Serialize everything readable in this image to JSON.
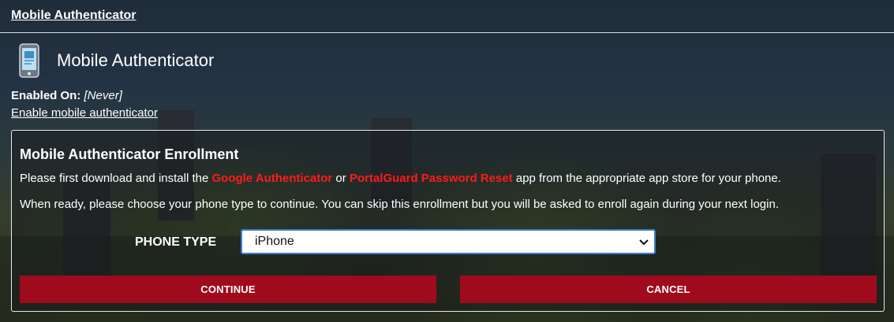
{
  "topbar": {
    "link_label": "Mobile Authenticator"
  },
  "header": {
    "title": "Mobile Authenticator",
    "icon": "mobile-phone-icon"
  },
  "status": {
    "enabled_label": "Enabled On:",
    "enabled_value": "[Never]",
    "enable_link": "Enable mobile authenticator"
  },
  "enrollment": {
    "title": "Mobile Authenticator Enrollment",
    "intro_before": "Please first download and install the ",
    "app1": "Google Authenticator",
    "intro_mid": " or ",
    "app2": "PortalGuard Password Reset",
    "intro_after": " app from the appropriate app store for your phone.",
    "instructions": "When ready, please choose your phone type to continue. You can skip this enrollment but you will be asked to enroll again during your next login.",
    "phone_type_label": "PHONE TYPE",
    "phone_type_value": "iPhone",
    "continue_label": "CONTINUE",
    "cancel_label": "CANCEL"
  },
  "colors": {
    "accent_red": "#ff1a1a",
    "button_red": "#a00a1d",
    "select_focus_border": "#3b7bd1"
  }
}
